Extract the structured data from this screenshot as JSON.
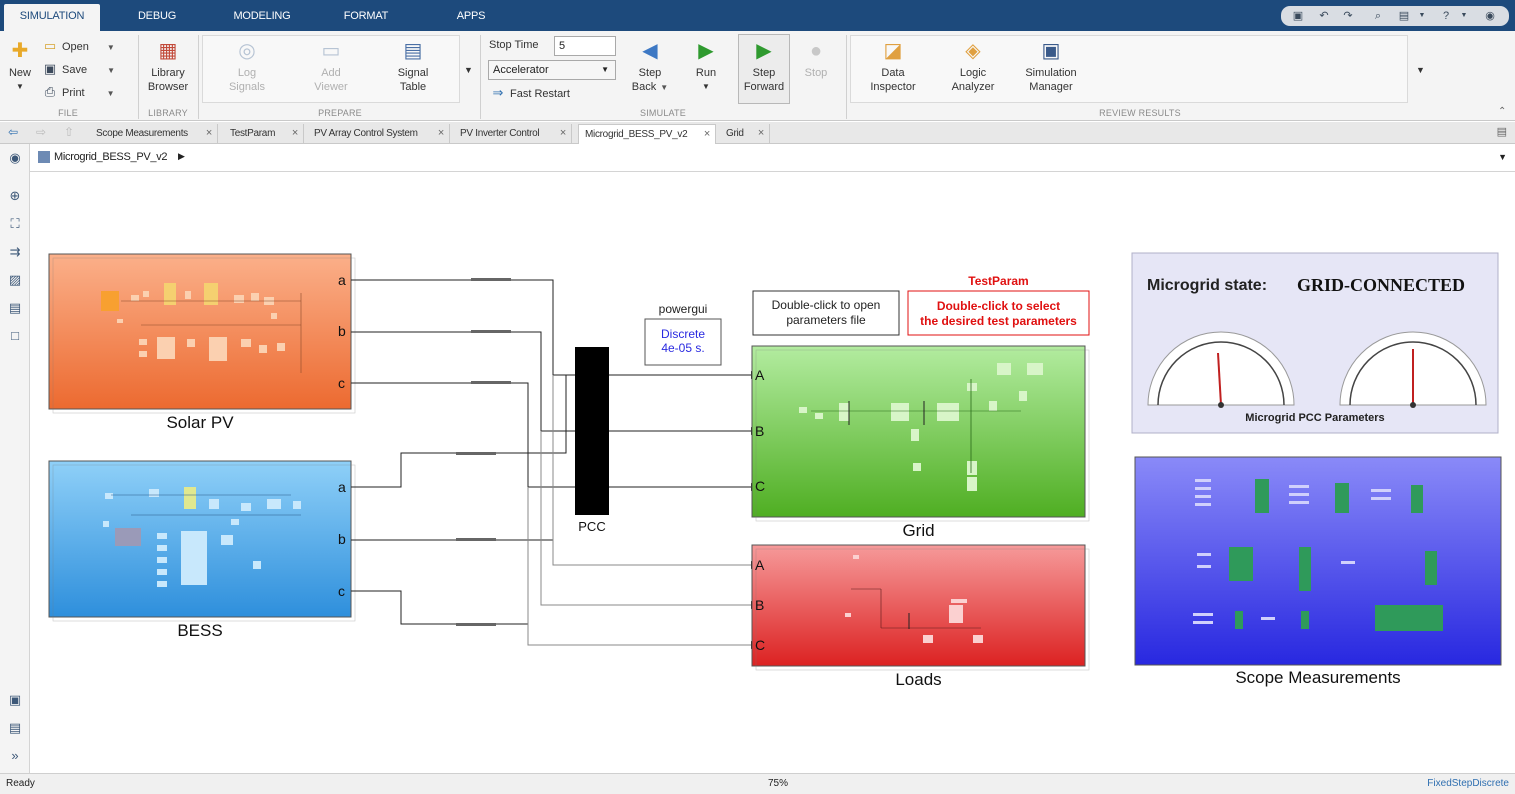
{
  "ribbon_tabs": [
    {
      "label": "SIMULATION",
      "active": true
    },
    {
      "label": "DEBUG"
    },
    {
      "label": "MODELING"
    },
    {
      "label": "FORMAT"
    },
    {
      "label": "APPS"
    }
  ],
  "file_group": {
    "new_label": "New",
    "open_label": "Open",
    "save_label": "Save",
    "print_label": "Print",
    "section": "FILE"
  },
  "library_group": {
    "browser_label_1": "Library",
    "browser_label_2": "Browser",
    "section": "LIBRARY"
  },
  "prepare_group": {
    "log_1": "Log",
    "log_2": "Signals",
    "add_1": "Add",
    "add_2": "Viewer",
    "signal_1": "Signal",
    "signal_2": "Table",
    "section": "PREPARE"
  },
  "simulate_group": {
    "stop_time_label": "Stop Time",
    "stop_time_value": "5",
    "mode_value": "Accelerator",
    "fast_restart_label": "Fast Restart",
    "step_back_1": "Step",
    "step_back_2": "Back",
    "run_label": "Run",
    "step_fwd_1": "Step",
    "step_fwd_2": "Forward",
    "stop_label": "Stop",
    "section": "SIMULATE"
  },
  "review_group": {
    "data_1": "Data",
    "data_2": "Inspector",
    "logic_1": "Logic",
    "logic_2": "Analyzer",
    "sim_1": "Simulation",
    "sim_2": "Manager",
    "section": "REVIEW RESULTS"
  },
  "doc_tabs": [
    {
      "label": "Scope Measurements"
    },
    {
      "label": "TestParam"
    },
    {
      "label": "PV Array Control System"
    },
    {
      "label": "PV Inverter Control"
    },
    {
      "label": "Microgrid_BESS_PV_v2",
      "active": true
    },
    {
      "label": "Grid"
    }
  ],
  "breadcrumb": "Microgrid_BESS_PV_v2",
  "blocks": {
    "solar_pv": "Solar PV",
    "bess": "BESS",
    "pcc": "PCC",
    "grid": "Grid",
    "loads": "Loads",
    "scope": "Scope Measurements",
    "powergui_title": "powergui",
    "powergui_line1": "Discrete",
    "powergui_line2": "4e-05 s.",
    "params_line1": "Double-click to open",
    "params_line2": "parameters file",
    "testparam_title": "TestParam",
    "testparam_line1": "Double-click to select",
    "testparam_line2": "the desired test parameters",
    "state_label": "Microgrid state:",
    "state_value": "GRID-CONNECTED",
    "gauge_panel_label": "Microgrid PCC Parameters"
  },
  "ports": {
    "lower": [
      "a",
      "b",
      "c"
    ],
    "upper": [
      "A",
      "B",
      "C"
    ]
  },
  "status": {
    "left": "Ready",
    "zoom": "75%",
    "solver": "FixedStepDiscrete"
  },
  "colors": {
    "ribbon_bar": "#1d4a7c",
    "solar": "#f07a45",
    "bess": "#3ea0e6",
    "grid": "#62c034",
    "loads": "#e83a3a",
    "scope": "#3a3ae8",
    "gauge_panel": "#e6e6f6",
    "testparam_red": "#e01010",
    "powergui_blue": "#2a2ae0"
  }
}
